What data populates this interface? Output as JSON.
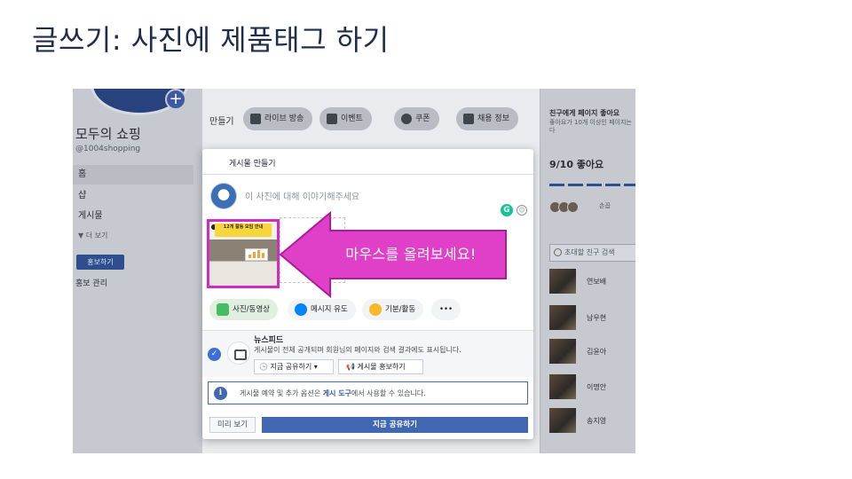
{
  "slide_title": "글쓰기: 사진에 제품태그 하기",
  "colors": {
    "accent": "#4267b2",
    "highlight": "#d22bc0",
    "arrow_fill": "#e040c8"
  },
  "page": {
    "cover_text": "",
    "name": "모두의 쇼핑",
    "handle": "@1004shopping",
    "nav": [
      "홈",
      "샵",
      "게시물"
    ],
    "more": "▼ 더 보기",
    "promote_label": "홍보하기",
    "promo_manage": "홍보 관리"
  },
  "toolbar": {
    "create_label": "만들기",
    "buttons": [
      {
        "label": "라이브 방송",
        "icon": "video-icon"
      },
      {
        "label": "이벤트",
        "icon": "calendar-icon"
      },
      {
        "label": "쿠폰",
        "icon": "coupon-icon"
      },
      {
        "label": "채용 정보",
        "icon": "briefcase-icon"
      }
    ]
  },
  "right": {
    "invite_title": "친구에게 페이지 좋아요",
    "invite_sub": "좋아요가 10개 이상인 페이지는 다",
    "likes": "9/10 좋아요",
    "liked_by": "손꼽",
    "search_placeholder": "초대할 친구 검색",
    "friends": [
      "연보배",
      "남우현",
      "김윤아",
      "이명안",
      "송지영"
    ]
  },
  "composer": {
    "title": "게시물 만들기",
    "placeholder": "이 사진에 대해 이야기해주세요",
    "thumb_banner": "12개 활동 모임 안내",
    "arrow_text": "마우스를 올려보세요!",
    "actions": [
      {
        "label": "사진/동영상",
        "icon": "photo-icon",
        "color": "#45bd62"
      },
      {
        "label": "메시지 유도",
        "icon": "messenger-icon",
        "color": "#0084ff"
      },
      {
        "label": "기분/활동",
        "icon": "emoji-icon",
        "color": "#f7b928"
      },
      {
        "label": "•••",
        "icon": "more-icon",
        "color": ""
      }
    ],
    "feed": {
      "title": "뉴스피드",
      "desc": "게시물이 전체 공개되며 회원님의 페이지와 검색 결과에도 표시됩니다.",
      "share_select": "지금 공유하기",
      "promote_post": "게시물 홍보하기"
    },
    "info": {
      "text_before": "게시물 예약 및 추가 옵션은 ",
      "link": "게시 도구",
      "text_after": "에서 사용할 수 있습니다."
    },
    "preview_label": "미리 보기",
    "share_now_label": "지금 공유하기"
  }
}
